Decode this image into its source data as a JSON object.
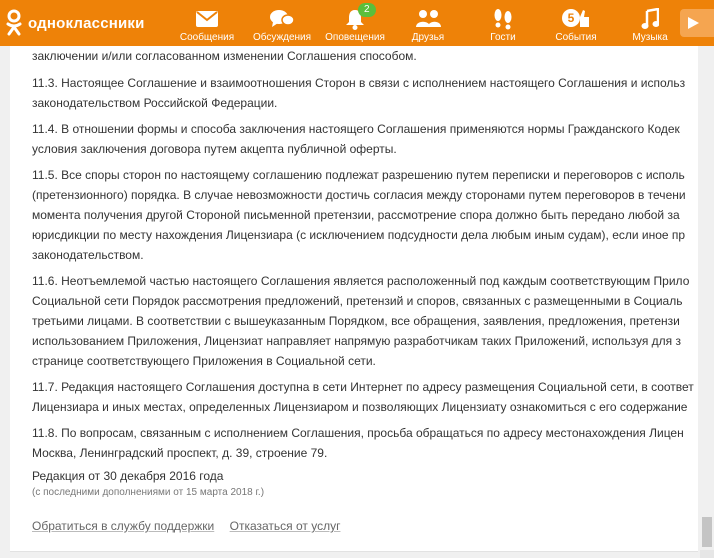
{
  "brand": {
    "name": "одноклассники",
    "color": "#ee8208"
  },
  "nav": [
    {
      "label": "Сообщения",
      "icon": "envelope-icon"
    },
    {
      "label": "Обсуждения",
      "icon": "chat-bubbles-icon"
    },
    {
      "label": "Оповещения",
      "icon": "bell-icon",
      "badge": "2"
    },
    {
      "label": "Друзья",
      "icon": "people-icon"
    },
    {
      "label": "Гости",
      "icon": "footprints-icon"
    },
    {
      "label": "События",
      "icon": "events-icon",
      "badge": "5"
    },
    {
      "label": "Музыка",
      "icon": "music-note-icon"
    }
  ],
  "doc": {
    "top_line": "заключении и/или согласованном изменении Соглашения способом.",
    "paragraphs": [
      [
        "11.3. Настоящее Соглашение и взаимоотношения Сторон в связи с исполнением настоящего Соглашения и использ",
        "законодательством Российской Федерации."
      ],
      [
        "11.4. В отношении формы и способа заключения настоящего Соглашения применяются нормы Гражданского Кодек",
        "условия заключения договора путем акцепта публичной оферты."
      ],
      [
        "11.5. Все споры сторон по настоящему соглашению подлежат разрешению путем переписки и переговоров с исполь",
        "(претензионного) порядка. В случае невозможности достичь согласия между сторонами путем переговоров в течени",
        "момента получения другой Стороной письменной претензии, рассмотрение спора должно быть передано любой за",
        "юрисдикции по месту нахождения Лицензиара (с исключением подсудности дела любым иным судам), если иное пр",
        "законодательством."
      ],
      [
        "11.6. Неотъемлемой частью настоящего Соглашения является расположенный под каждым соответствующим Прило",
        "Социальной сети Порядок рассмотрения предложений, претензий и споров, связанных с размещенными в Социаль",
        "третьими лицами. В соответствии с вышеуказанным Порядком, все обращения, заявления, предложения, претензи",
        "использованием Приложения, Лицензиат направляет напрямую разработчикам таких Приложений, используя для з",
        "странице соответствующего Приложения в Социальной сети."
      ],
      [
        "11.7. Редакция настоящего Соглашения доступна в сети Интернет по адресу размещения Социальной сети, в соответ",
        "Лицензиара и иных местах, определенных Лицензиаром и позволяющих Лицензиату ознакомиться с его содержание"
      ],
      [
        "11.8. По вопросам, связанным с исполнением Соглашения, просьба обращаться по адресу местонахождения Лицен",
        "Москва, Ленинградский проспект, д. 39, строение 79."
      ]
    ],
    "edition": "Редакция от 30 декабря 2016 года",
    "edition_note": "(с последними дополнениями от 15 марта 2018 г.)"
  },
  "links": {
    "support": "Обратиться в службу поддержки",
    "unsubscribe": "Отказаться от услуг"
  }
}
